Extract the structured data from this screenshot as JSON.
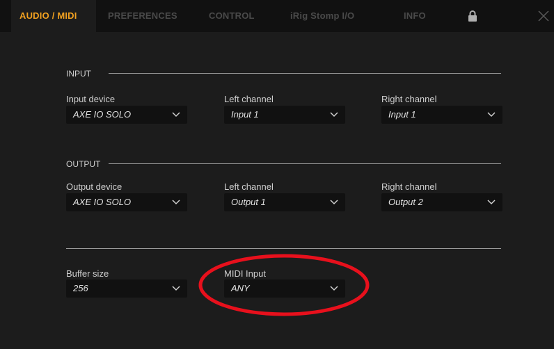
{
  "tabs": [
    {
      "label": "AUDIO / MIDI",
      "active": true
    },
    {
      "label": "PREFERENCES",
      "active": false
    },
    {
      "label": "CONTROL",
      "active": false
    },
    {
      "label": "iRig Stomp I/O",
      "active": false
    },
    {
      "label": "INFO",
      "active": false
    }
  ],
  "icons": {
    "lock": "lock-icon",
    "close": "close-icon",
    "dropdown": "chevron-down-icon"
  },
  "colors": {
    "accent": "#f0a020",
    "background": "#1c1c1c",
    "tabbar": "#111111",
    "annotation": "#e8101c"
  },
  "input": {
    "section_label": "INPUT",
    "device_label": "Input device",
    "device_value": "AXE IO SOLO",
    "left_label": "Left channel",
    "left_value": "Input 1",
    "right_label": "Right channel",
    "right_value": "Input 1"
  },
  "output": {
    "section_label": "OUTPUT",
    "device_label": "Output device",
    "device_value": "AXE IO SOLO",
    "left_label": "Left channel",
    "left_value": "Output 1",
    "right_label": "Right channel",
    "right_value": "Output 2"
  },
  "misc": {
    "buffer_label": "Buffer size",
    "buffer_value": "256",
    "midi_label": "MIDI Input",
    "midi_value": "ANY"
  }
}
